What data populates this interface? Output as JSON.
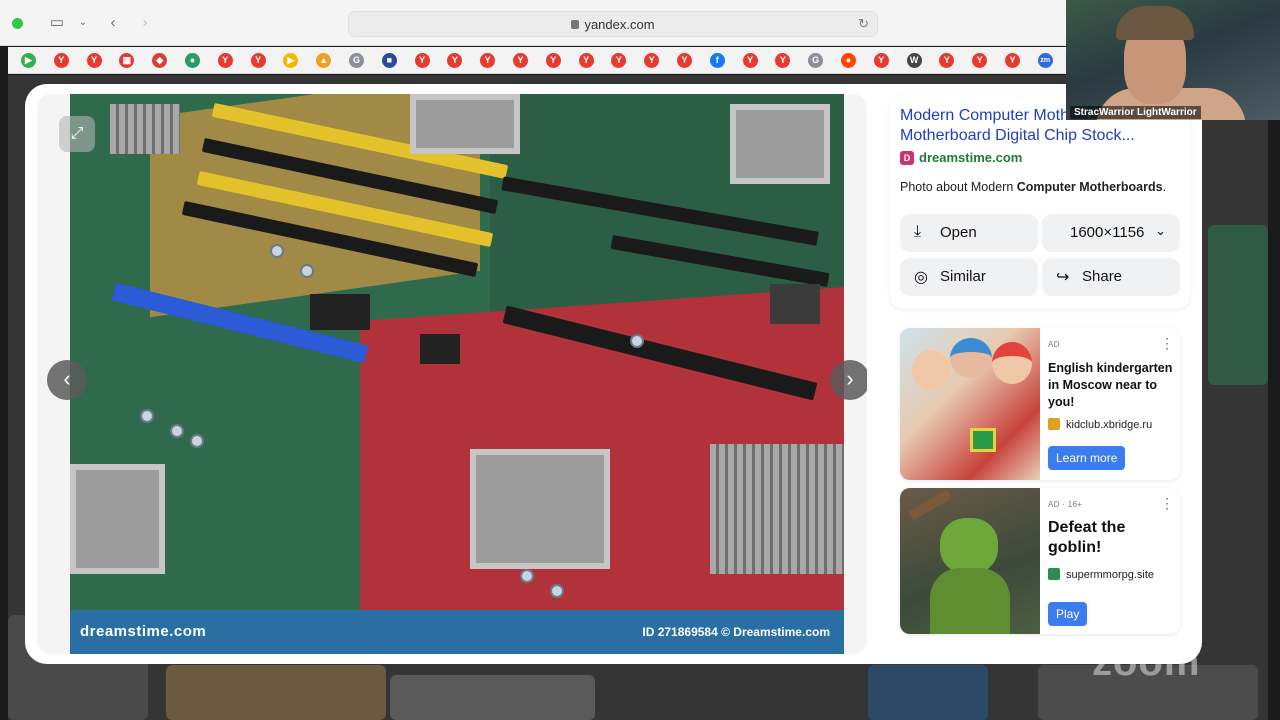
{
  "browser": {
    "url": "yandex.com"
  },
  "bookmarks": [
    {
      "icon": "play-icon",
      "color": "#2fb34a",
      "glyph": "▶"
    },
    {
      "icon": "yandex-icon",
      "color": "#e63b2e",
      "glyph": "Y"
    },
    {
      "icon": "yandex-icon",
      "color": "#e63b2e",
      "glyph": "Y"
    },
    {
      "icon": "grid-icon",
      "color": "#e23a3a",
      "glyph": "▦"
    },
    {
      "icon": "map-pin-icon",
      "color": "#d9413b",
      "glyph": "◆"
    },
    {
      "icon": "globe-icon",
      "color": "#2a9a6a",
      "glyph": "●"
    },
    {
      "icon": "yandex-icon",
      "color": "#e63b2e",
      "glyph": "Y"
    },
    {
      "icon": "yandex-icon",
      "color": "#e63b2e",
      "glyph": "Y"
    },
    {
      "icon": "play-icon",
      "color": "#f0b800",
      "glyph": "▶"
    },
    {
      "icon": "photo-icon",
      "color": "#f0a020",
      "glyph": "▲"
    },
    {
      "icon": "g-icon",
      "color": "#8a8f98",
      "glyph": "G"
    },
    {
      "icon": "flag-icon",
      "color": "#2a4a9a",
      "glyph": "■"
    },
    {
      "icon": "yandex-icon",
      "color": "#e63b2e",
      "glyph": "Y"
    },
    {
      "icon": "yandex-icon",
      "color": "#e63b2e",
      "glyph": "Y"
    },
    {
      "icon": "yandex-icon",
      "color": "#e63b2e",
      "glyph": "Y"
    },
    {
      "icon": "yandex-icon",
      "color": "#e63b2e",
      "glyph": "Y"
    },
    {
      "icon": "yandex-icon",
      "color": "#e63b2e",
      "glyph": "Y"
    },
    {
      "icon": "yandex-icon",
      "color": "#e63b2e",
      "glyph": "Y"
    },
    {
      "icon": "yandex-icon",
      "color": "#e63b2e",
      "glyph": "Y"
    },
    {
      "icon": "yandex-icon",
      "color": "#e63b2e",
      "glyph": "Y"
    },
    {
      "icon": "yandex-icon",
      "color": "#e63b2e",
      "glyph": "Y"
    },
    {
      "icon": "facebook-icon",
      "color": "#1877f2",
      "glyph": "f"
    },
    {
      "icon": "yandex-icon",
      "color": "#e63b2e",
      "glyph": "Y"
    },
    {
      "icon": "yandex-icon",
      "color": "#e63b2e",
      "glyph": "Y"
    },
    {
      "icon": "g-icon",
      "color": "#8a8f98",
      "glyph": "G"
    },
    {
      "icon": "reddit-icon",
      "color": "#ff4500",
      "glyph": "●"
    },
    {
      "icon": "yandex-icon",
      "color": "#e63b2e",
      "glyph": "Y"
    },
    {
      "icon": "wikipedia-icon",
      "color": "#444444",
      "glyph": "W"
    },
    {
      "icon": "yandex-icon",
      "color": "#e63b2e",
      "glyph": "Y"
    },
    {
      "icon": "yandex-icon",
      "color": "#e63b2e",
      "glyph": "Y"
    },
    {
      "icon": "yandex-icon",
      "color": "#e63b2e",
      "glyph": "Y"
    },
    {
      "icon": "zoom-icon",
      "color": "#2d6cdf",
      "glyph": "zm"
    }
  ],
  "viewer": {
    "watermark_logo": "dreamstime.com",
    "watermark_id": "ID 271869584 © Dreamstime.com"
  },
  "info": {
    "title": "Modern Computer Motherboards Motherboard Digital Chip Stock...",
    "source": "dreamstime.com",
    "about_prefix": "Photo about Modern ",
    "about_bold": "Computer Motherboards",
    "about_suffix": ".",
    "open_label": "Open",
    "size_label": "1600×1156",
    "similar_label": "Similar",
    "share_label": "Share"
  },
  "ads": [
    {
      "tag": "AD",
      "title": "English kindergarten in Moscow near to you!",
      "site": "kidclub.xbridge.ru",
      "button": "Learn more",
      "site_color": "#e0a020"
    },
    {
      "tag": "AD · 16+",
      "title": "Defeat the goblin!",
      "site": "supermmorpg.site",
      "button": "Play",
      "site_color": "#2f8a55"
    }
  ],
  "webcam": {
    "name": "StracWarrior LightWarrior"
  },
  "zoom_watermark": "zoom"
}
